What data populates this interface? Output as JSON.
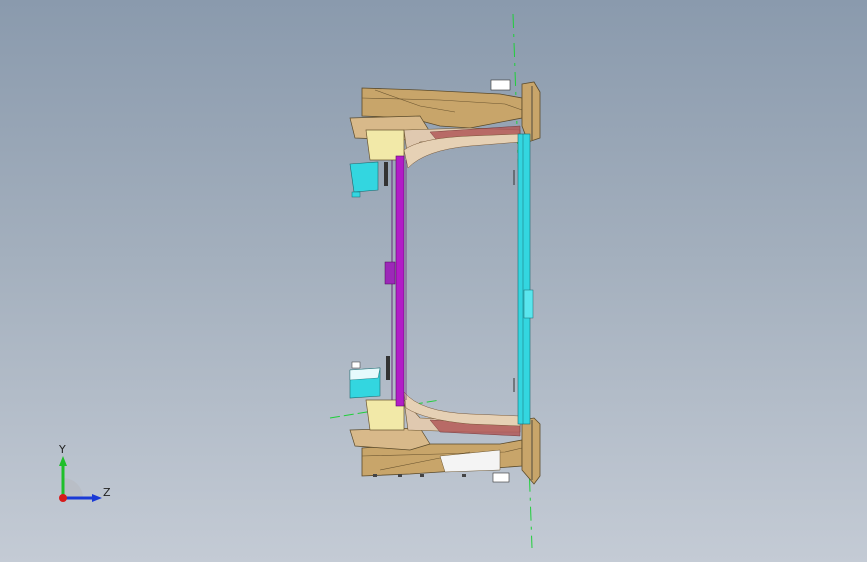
{
  "viewport": {
    "background_top": "#8a9aad",
    "background_bottom": "#c4cbd5"
  },
  "triad": {
    "y_label": "Y",
    "z_label": "Z",
    "y_color": "#1fbf2a",
    "z_color": "#1a3ad6",
    "x_color": "#d61a1a"
  },
  "model": {
    "frame_color": "#c8a56a",
    "accent_magenta": "#b21cc7",
    "accent_cyan": "#33d6e0",
    "accent_red": "#b25a5a",
    "bracket_pale": "#f2e9a8"
  }
}
